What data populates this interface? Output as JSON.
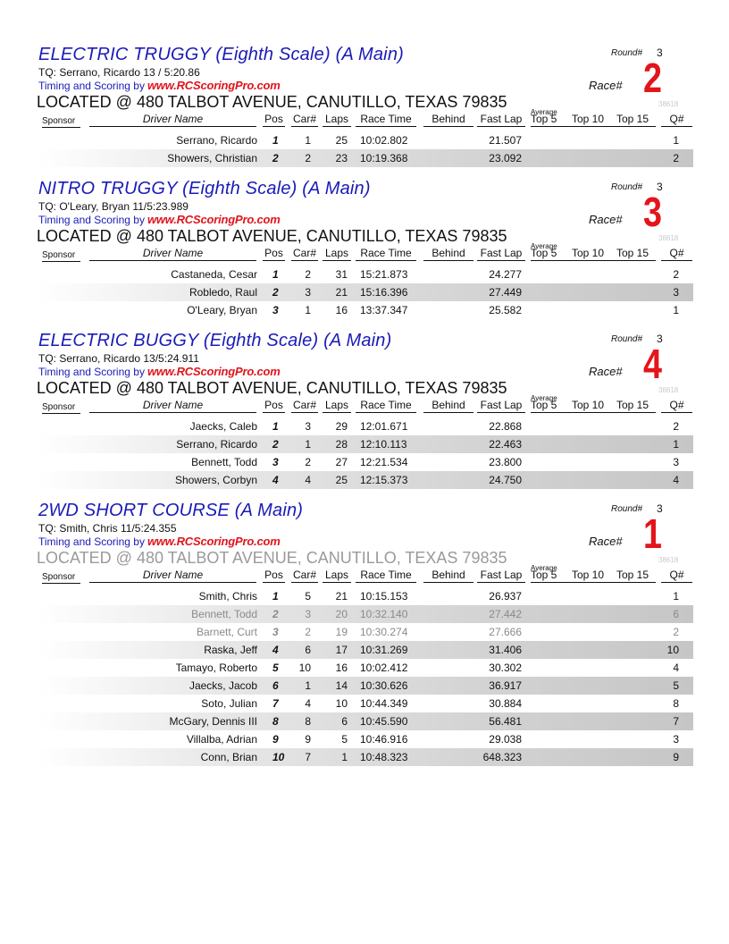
{
  "header_labels": {
    "round": "Round#",
    "race": "Race#",
    "timing_prefix": "Timing and Scoring by",
    "timing_site": "www.RCScoringPro.com",
    "located": "LOCATED @ 480 TALBOT AVENUE, CANUTILLO, TEXAS 79835",
    "code": "38618",
    "average": "Average"
  },
  "columns": {
    "sponsor": "Sponsor",
    "driver": "Driver Name",
    "pos": "Pos",
    "car": "Car#",
    "laps": "Laps",
    "race_time": "Race Time",
    "behind": "Behind",
    "fast_lap": "Fast Lap",
    "top5": "Top 5",
    "top10": "Top 10",
    "top15": "Top 15",
    "q": "Q#"
  },
  "races": [
    {
      "title": "ELECTRIC TRUGGY (Eighth Scale) (A Main)",
      "tq": "TQ: Serrano, Ricardo 13 / 5:20.86",
      "round": "3",
      "race_number": "2",
      "results": [
        {
          "driver": "Serrano, Ricardo",
          "pos": "1",
          "car": "1",
          "laps": "25",
          "race_time": "10:02.802",
          "behind": "",
          "fast_lap": "21.507",
          "q": "1"
        },
        {
          "driver": "Showers, Christian",
          "pos": "2",
          "car": "2",
          "laps": "23",
          "race_time": "10:19.368",
          "behind": "",
          "fast_lap": "23.092",
          "q": "2"
        }
      ]
    },
    {
      "title": "NITRO TRUGGY (Eighth Scale) (A Main)",
      "tq": "TQ: O'Leary, Bryan 11/5:23.989",
      "round": "3",
      "race_number": "3",
      "results": [
        {
          "driver": "Castaneda, Cesar",
          "pos": "1",
          "car": "2",
          "laps": "31",
          "race_time": "15:21.873",
          "behind": "",
          "fast_lap": "24.277",
          "q": "2"
        },
        {
          "driver": "Robledo, Raul",
          "pos": "2",
          "car": "3",
          "laps": "21",
          "race_time": "15:16.396",
          "behind": "",
          "fast_lap": "27.449",
          "q": "3"
        },
        {
          "driver": "O'Leary, Bryan",
          "pos": "3",
          "car": "1",
          "laps": "16",
          "race_time": "13:37.347",
          "behind": "",
          "fast_lap": "25.582",
          "q": "1"
        }
      ]
    },
    {
      "title": "ELECTRIC BUGGY (Eighth Scale) (A Main)",
      "tq": "TQ: Serrano, Ricardo 13/5:24.911",
      "round": "3",
      "race_number": "4",
      "results": [
        {
          "driver": "Jaecks, Caleb",
          "pos": "1",
          "car": "3",
          "laps": "29",
          "race_time": "12:01.671",
          "behind": "",
          "fast_lap": "22.868",
          "q": "2"
        },
        {
          "driver": "Serrano, Ricardo",
          "pos": "2",
          "car": "1",
          "laps": "28",
          "race_time": "12:10.113",
          "behind": "",
          "fast_lap": "22.463",
          "q": "1"
        },
        {
          "driver": "Bennett, Todd",
          "pos": "3",
          "car": "2",
          "laps": "27",
          "race_time": "12:21.534",
          "behind": "",
          "fast_lap": "23.800",
          "q": "3"
        },
        {
          "driver": "Showers, Corbyn",
          "pos": "4",
          "car": "4",
          "laps": "25",
          "race_time": "12:15.373",
          "behind": "",
          "fast_lap": "24.750",
          "q": "4"
        }
      ]
    },
    {
      "title": "2WD SHORT COURSE (A Main)",
      "tq": "TQ: Smith, Chris 11/5:24.355",
      "round": "3",
      "race_number": "1",
      "results": [
        {
          "driver": "Smith, Chris",
          "pos": "1",
          "car": "5",
          "laps": "21",
          "race_time": "10:15.153",
          "behind": "",
          "fast_lap": "26.937",
          "q": "1"
        },
        {
          "driver": "Bennett, Todd",
          "pos": "2",
          "car": "3",
          "laps": "20",
          "race_time": "10:32.140",
          "behind": "",
          "fast_lap": "27.442",
          "q": "6"
        },
        {
          "driver": "Barnett, Curt",
          "pos": "3",
          "car": "2",
          "laps": "19",
          "race_time": "10:30.274",
          "behind": "",
          "fast_lap": "27.666",
          "q": "2"
        },
        {
          "driver": "Raska, Jeff",
          "pos": "4",
          "car": "6",
          "laps": "17",
          "race_time": "10:31.269",
          "behind": "",
          "fast_lap": "31.406",
          "q": "10"
        },
        {
          "driver": "Tamayo, Roberto",
          "pos": "5",
          "car": "10",
          "laps": "16",
          "race_time": "10:02.412",
          "behind": "",
          "fast_lap": "30.302",
          "q": "4"
        },
        {
          "driver": "Jaecks, Jacob",
          "pos": "6",
          "car": "1",
          "laps": "14",
          "race_time": "10:30.626",
          "behind": "",
          "fast_lap": "36.917",
          "q": "5"
        },
        {
          "driver": "Soto, Julian",
          "pos": "7",
          "car": "4",
          "laps": "10",
          "race_time": "10:44.349",
          "behind": "",
          "fast_lap": "30.884",
          "q": "8"
        },
        {
          "driver": "McGary, Dennis III",
          "pos": "8",
          "car": "8",
          "laps": "6",
          "race_time": "10:45.590",
          "behind": "",
          "fast_lap": "56.481",
          "q": "7"
        },
        {
          "driver": "Villalba, Adrian",
          "pos": "9",
          "car": "9",
          "laps": "5",
          "race_time": "10:46.916",
          "behind": "",
          "fast_lap": "29.038",
          "q": "3"
        },
        {
          "driver": "Conn, Brian",
          "pos": "10",
          "car": "7",
          "laps": "1",
          "race_time": "10:48.323",
          "behind": "",
          "fast_lap": "648.323",
          "q": "9"
        }
      ]
    }
  ]
}
